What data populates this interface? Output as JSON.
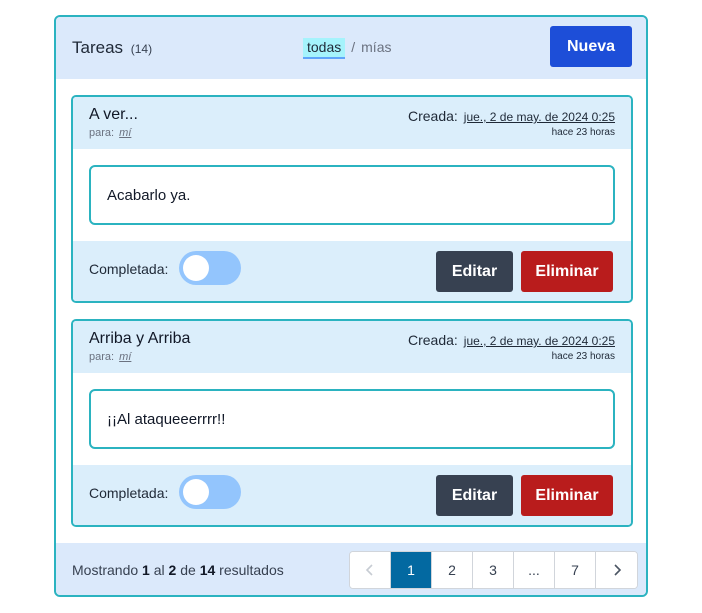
{
  "header": {
    "title": "Tareas",
    "count": "(14)",
    "filter_all": "todas",
    "filter_sep": "/",
    "filter_mine": "mías",
    "new_label": "Nueva"
  },
  "tasks": [
    {
      "title": "A ver...",
      "for_label": "para:",
      "for_who": "mí",
      "created_label": "Creada:",
      "created_date": "jue., 2 de may. de 2024 0:25",
      "created_ago": "hace 23 horas",
      "content": "Acabarlo ya.",
      "done_label": "Completada:",
      "completed": false,
      "edit_label": "Editar",
      "delete_label": "Eliminar"
    },
    {
      "title": "Arriba y Arriba",
      "for_label": "para:",
      "for_who": "mí",
      "created_label": "Creada:",
      "created_date": "jue., 2 de may. de 2024 0:25",
      "created_ago": "hace 23 horas",
      "content": "¡¡Al ataqueeerrrr!!",
      "done_label": "Completada:",
      "completed": false,
      "edit_label": "Editar",
      "delete_label": "Eliminar"
    }
  ],
  "footer": {
    "showing_prefix": "Mostrando",
    "from": "1",
    "mid": "al",
    "to": "2",
    "of": "de",
    "total": "14",
    "suffix": "resultados"
  },
  "pagination": {
    "prev_icon": "chevron-left-icon",
    "next_icon": "chevron-right-icon",
    "pages": [
      "1",
      "2",
      "3",
      "...",
      "7"
    ],
    "current": "1"
  },
  "colors": {
    "accent": "#2bb3c0",
    "primary": "#1d4ed8",
    "danger": "#b91c1c",
    "dark": "#374151",
    "active_page": "#0369a1"
  }
}
